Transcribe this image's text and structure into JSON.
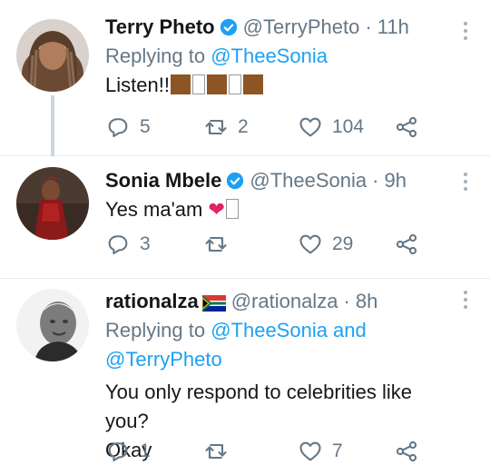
{
  "tweets": [
    {
      "name": "Terry Pheto",
      "handle": "@TerryPheto",
      "time": "· 11h",
      "reply_prefix": "Replying to",
      "reply_to": "@TheeSonia",
      "reply_to_2": "",
      "body": "Listen!!",
      "body_2": "",
      "replies": "5",
      "retweets": "2",
      "likes": "104",
      "verified": true
    },
    {
      "name": "Sonia Mbele",
      "handle": "@TheeSonia",
      "time": "· 9h",
      "body": "Yes ma'am",
      "replies": "3",
      "retweets": "",
      "likes": "29",
      "verified": true
    },
    {
      "name": "rationalza",
      "handle": "@rationalza",
      "time": "· 8h",
      "reply_prefix": "Replying to",
      "reply_to": "@TheeSonia and",
      "reply_to_2": "@TerryPheto",
      "body": "You only respond to celebrities like you?",
      "body_2": "Okay",
      "replies": "1",
      "retweets": "",
      "likes": "7",
      "verified": false
    }
  ],
  "colors": {
    "accent": "#1da1f2",
    "secondary_text": "#657786",
    "like_red": "#e0245e",
    "divider": "#e6ecf0"
  },
  "icons": [
    "verified-badge-icon",
    "reply-icon",
    "retweet-icon",
    "like-icon",
    "share-icon",
    "more-icon",
    "south-africa-flag-icon"
  ]
}
